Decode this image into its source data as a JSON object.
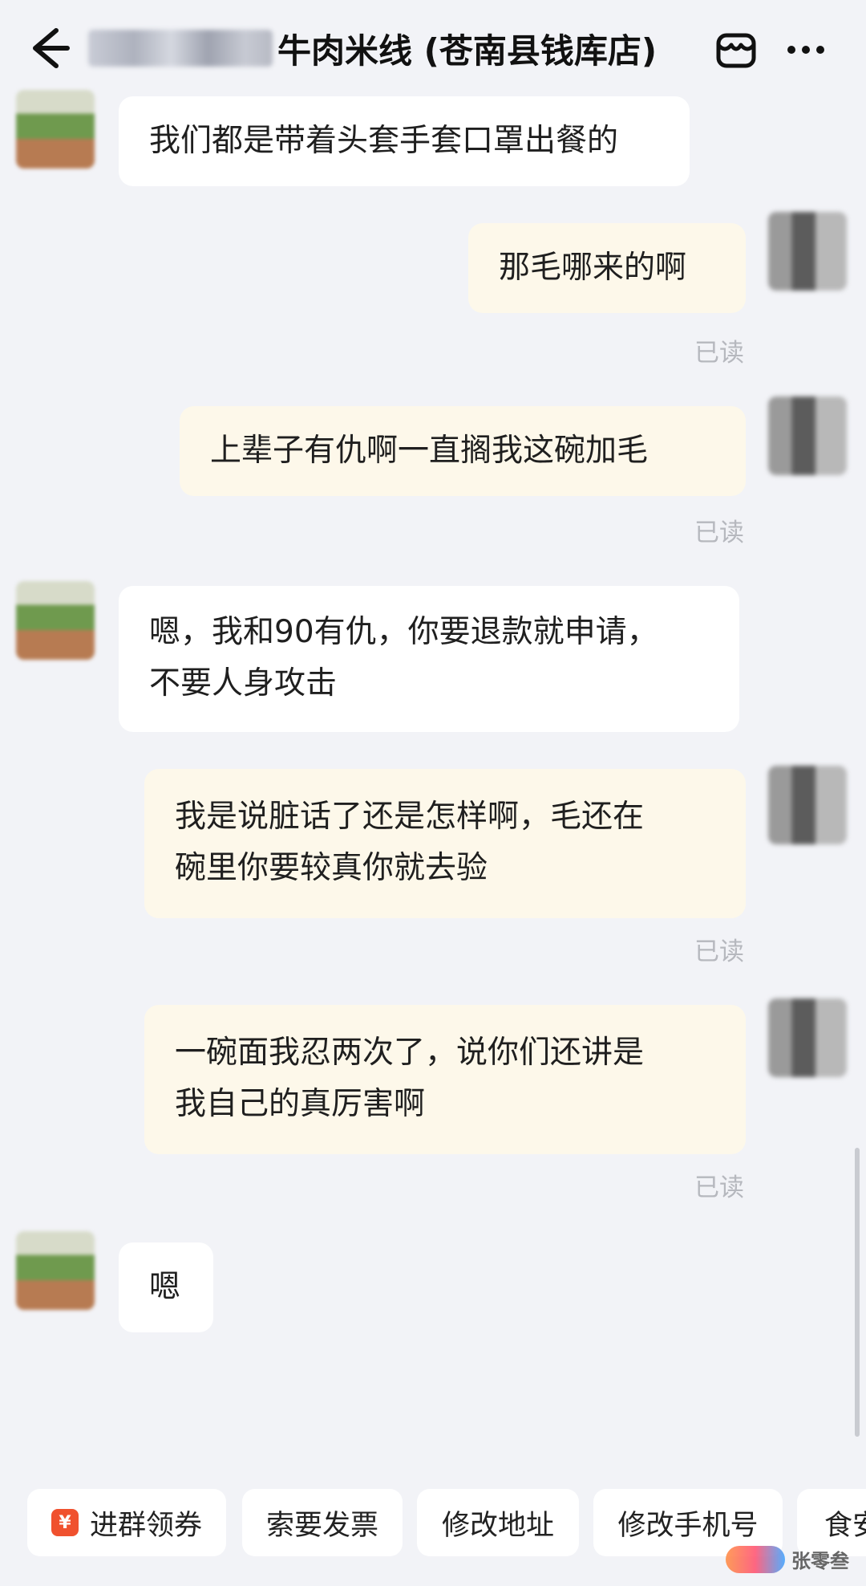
{
  "header": {
    "title": "牛肉米线 (苍南县钱库店)",
    "back_icon": "arrow-left-icon",
    "store_icon": "store-icon",
    "more_icon": "more-horizontal-icon"
  },
  "messages": [
    {
      "from": "shop",
      "lines": [
        "我们都是带着头套手套口罩出餐的"
      ]
    },
    {
      "from": "me",
      "lines": [
        "那毛哪来的啊"
      ],
      "status": "已读"
    },
    {
      "from": "me",
      "lines": [
        "上辈子有仇啊一直搁我这碗加毛"
      ],
      "status": "已读"
    },
    {
      "from": "shop",
      "lines": [
        "嗯，我和90有仇，你要退款就申请，",
        "不要人身攻击"
      ]
    },
    {
      "from": "me",
      "lines": [
        "我是说脏话了还是怎样啊，毛还在",
        "碗里你要较真你就去验"
      ],
      "status": "已读"
    },
    {
      "from": "me",
      "lines": [
        "一碗面我忍两次了，说你们还讲是",
        "我自己的真厉害啊"
      ],
      "status": "已读"
    },
    {
      "from": "shop",
      "lines": [
        "嗯"
      ]
    }
  ],
  "quick_replies": [
    {
      "label": "进群领券",
      "icon": "¥"
    },
    {
      "label": "索要发票"
    },
    {
      "label": "修改地址"
    },
    {
      "label": "修改手机号"
    },
    {
      "label": "食安"
    }
  ],
  "watermark": {
    "text": "张零叁"
  },
  "colors": {
    "background": "#f2f3f7",
    "incoming_bubble": "#ffffff",
    "outgoing_bubble": "#fdf8ea",
    "read_status": "#b6b8be",
    "coupon_icon": "#f0512e"
  }
}
